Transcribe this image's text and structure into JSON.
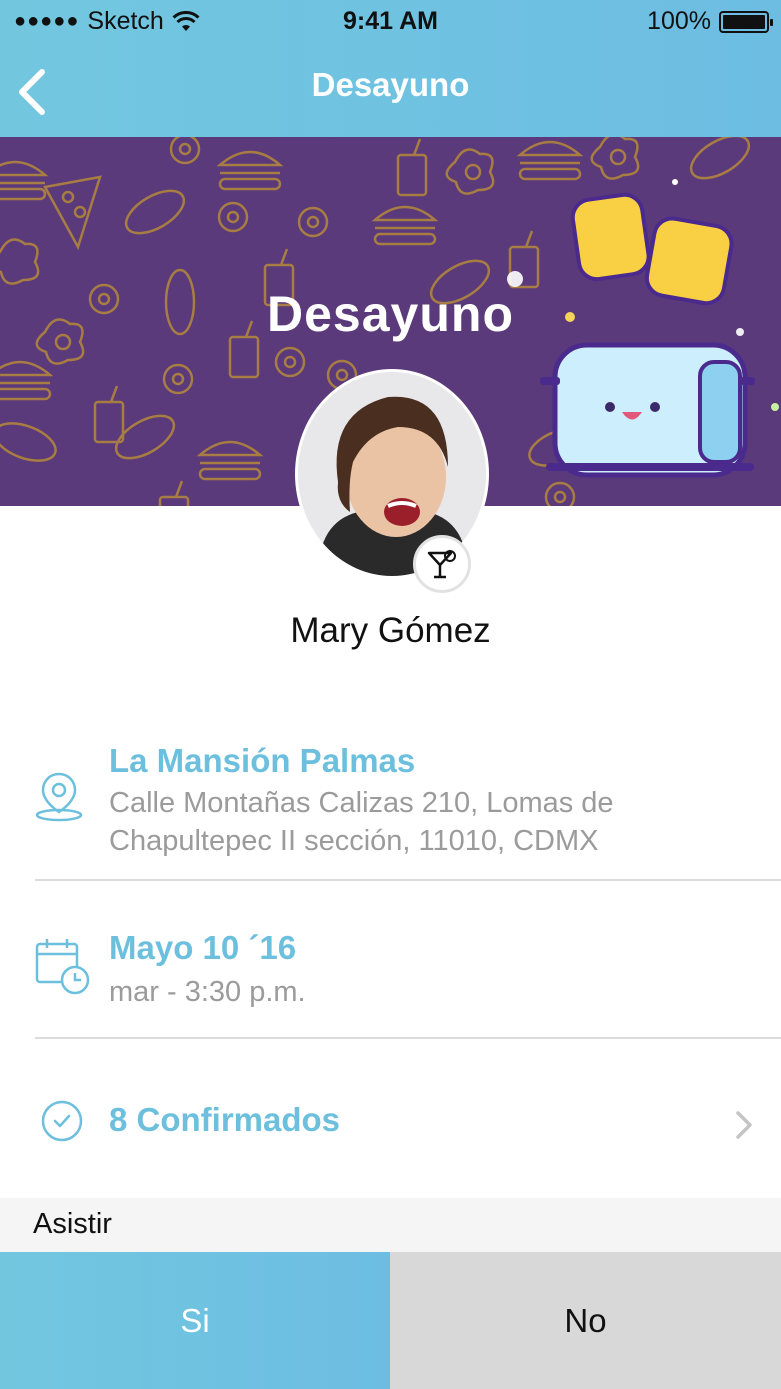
{
  "status_bar": {
    "signal_dots": "●●●●●",
    "carrier": "Sketch",
    "time": "9:41 AM",
    "battery": "100%",
    "icons": [
      "signal-dots-icon",
      "wifi-icon",
      "battery-icon"
    ]
  },
  "nav": {
    "title": "Desayuno",
    "back_icon": "chevron-left-icon"
  },
  "banner": {
    "title": "Desayuno",
    "background_color": "#5a3a7a",
    "pattern_color": "#b58a3a"
  },
  "host": {
    "name": "Mary Gómez",
    "badge_icon": "cocktail-icon"
  },
  "location": {
    "icon": "location-pin-icon",
    "title": "La Mansión Palmas",
    "address_line1": "Calle Montañas Calizas 210, Lomas de",
    "address_line2": "Chapultepec II sección, 11010, CDMX"
  },
  "date": {
    "icon": "calendar-clock-icon",
    "title": "Mayo 10 ´16",
    "time": "mar - 3:30 p.m."
  },
  "confirmed": {
    "icon": "check-circle-icon",
    "label": "8 Confirmados",
    "chevron_icon": "chevron-right-icon"
  },
  "attend": {
    "label": "Asistir",
    "yes": "Si",
    "no": "No"
  },
  "colors": {
    "accent": "#6cc0dd",
    "banner": "#5a3a7a",
    "muted_text": "#9b9b9b",
    "no_button": "#d8d8d8"
  }
}
